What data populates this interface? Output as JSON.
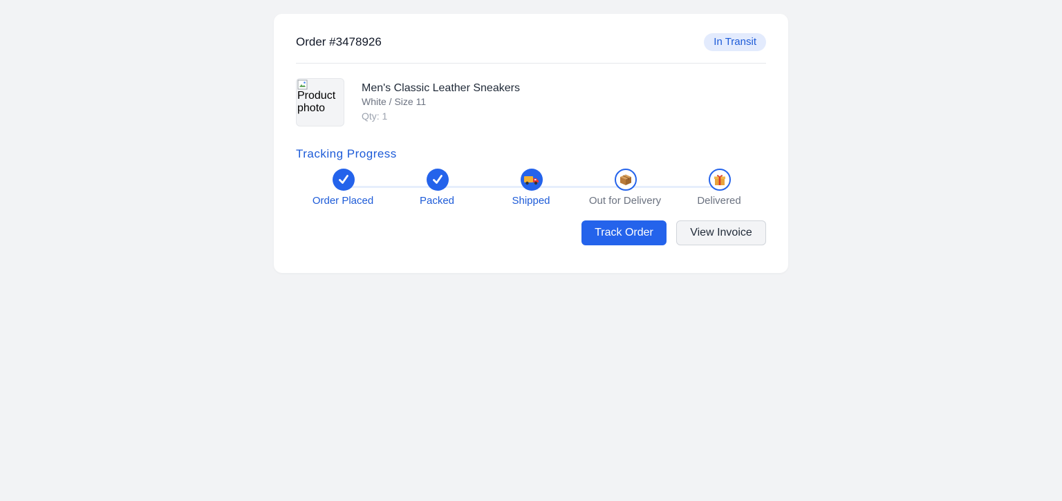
{
  "order": {
    "title": "Order #3478926",
    "status": "In Transit"
  },
  "product": {
    "image_alt": "Product photo",
    "name": "Men's Classic Leather Sneakers",
    "variant": "White / Size 11",
    "quantity": "Qty: 1"
  },
  "tracking": {
    "title": "Tracking Progress",
    "steps": [
      {
        "label": "Order Placed",
        "icon": "check-icon",
        "state": "completed"
      },
      {
        "label": "Packed",
        "icon": "check-icon",
        "state": "completed"
      },
      {
        "label": "Shipped",
        "icon": "truck-icon",
        "state": "current"
      },
      {
        "label": "Out for Delivery",
        "icon": "package-icon",
        "state": "pending"
      },
      {
        "label": "Delivered",
        "icon": "gift-icon",
        "state": "pending"
      }
    ]
  },
  "actions": {
    "track_label": "Track Order",
    "invoice_label": "View Invoice"
  },
  "colors": {
    "accent": "#2463eb",
    "badge_bg": "#e3ebfd",
    "page_bg": "#f2f3f5"
  }
}
